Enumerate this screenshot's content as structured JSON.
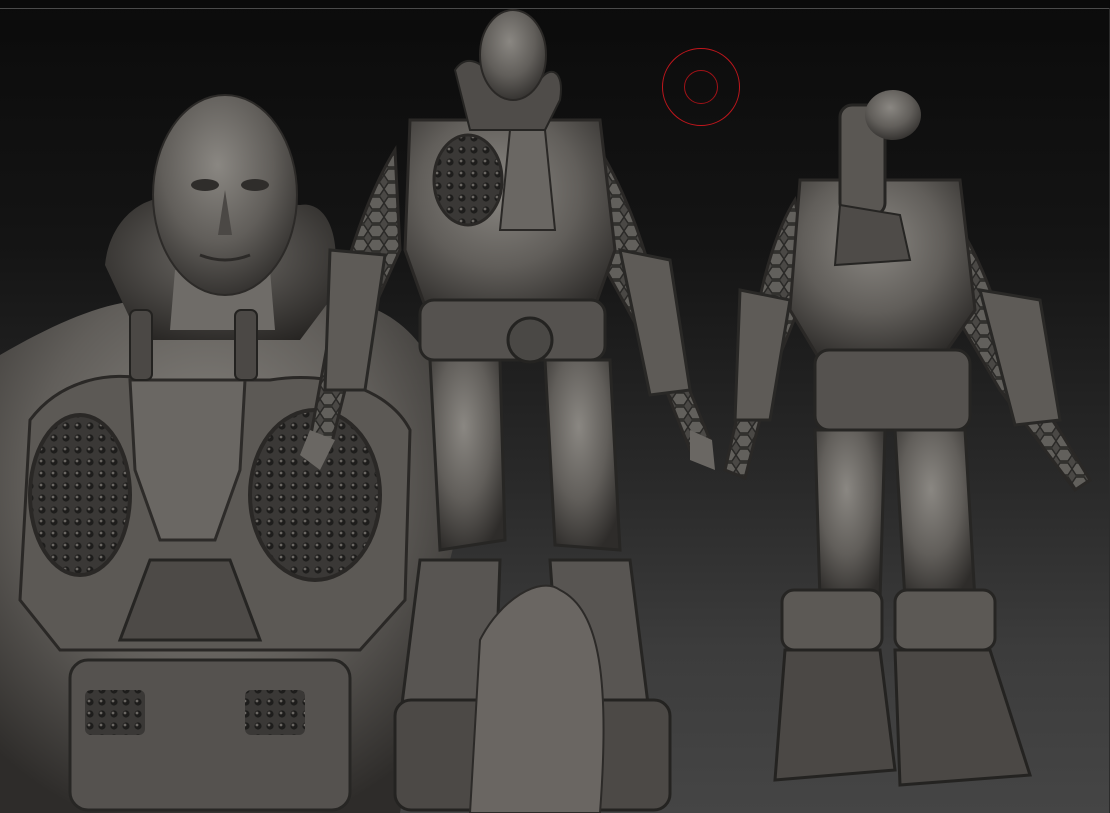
{
  "viewport": {
    "background_top": "#0b0b0b",
    "background_bottom": "#454545",
    "model_material_color": "#5f5c58"
  },
  "icons": {
    "brush_cursor": "draw-size-brush-cursor"
  }
}
